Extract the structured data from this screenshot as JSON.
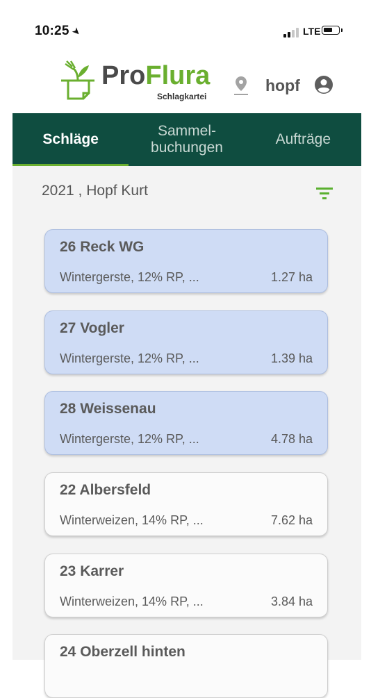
{
  "status_bar": {
    "time": "10:25",
    "network": "LTE"
  },
  "header": {
    "brand_pro": "Pro",
    "brand_flura": "Flura",
    "brand_subtitle": "Schlagkartei",
    "username": "hopf"
  },
  "tabs": [
    {
      "label": "Schläge",
      "active": true
    },
    {
      "label": "Sammel-\nbuchungen",
      "active": false
    },
    {
      "label": "Aufträge",
      "active": false
    }
  ],
  "filter": {
    "text": "2021 , Hopf Kurt"
  },
  "fields": [
    {
      "name": "26 Reck WG",
      "description": "Wintergerste, 12% RP, ...",
      "area": "1.27 ha",
      "selected": true
    },
    {
      "name": "27 Vogler",
      "description": "Wintergerste, 12% RP, ...",
      "area": "1.39 ha",
      "selected": true
    },
    {
      "name": "28 Weissenau",
      "description": "Wintergerste, 12% RP, ...",
      "area": "4.78 ha",
      "selected": true
    },
    {
      "name": "22 Albersfeld",
      "description": "Winterweizen, 14% RP, ...",
      "area": "7.62 ha",
      "selected": false
    },
    {
      "name": "23 Karrer",
      "description": "Winterweizen, 14% RP, ...",
      "area": "3.84 ha",
      "selected": false
    },
    {
      "name": "24 Oberzell hinten",
      "description": "",
      "area": "",
      "selected": false
    }
  ],
  "colors": {
    "brand_green": "#6aaf2f",
    "tab_bar": "#0f4d40",
    "selected_card": "#cfdcf5"
  },
  "icons": [
    "location-arrow-icon",
    "signal-icon",
    "battery-icon",
    "logo-icon",
    "map-pin-icon",
    "account-circle-icon",
    "filter-icon"
  ]
}
